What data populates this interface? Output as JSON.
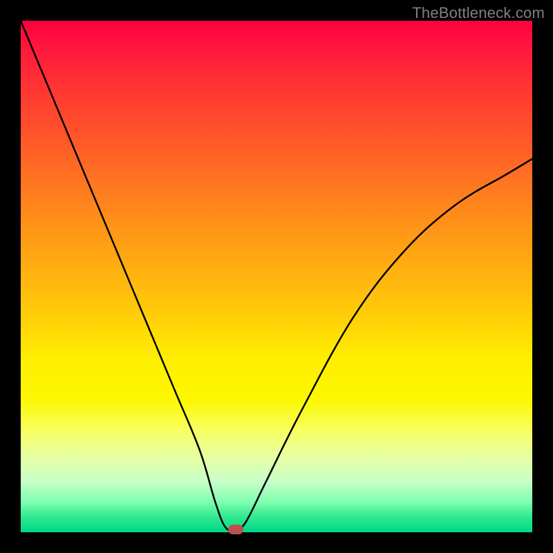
{
  "watermark": "TheBottleneck.com",
  "chart_data": {
    "type": "line",
    "title": "",
    "xlabel": "",
    "ylabel": "",
    "xlim": [
      0,
      100
    ],
    "ylim": [
      0,
      100
    ],
    "grid": false,
    "legend": false,
    "background_gradient": {
      "top": "#ff0040",
      "middle": "#ffee00",
      "bottom": "#00d888"
    },
    "series": [
      {
        "name": "bottleneck-curve",
        "color": "#000000",
        "x": [
          0,
          5,
          10,
          15,
          20,
          25,
          30,
          35,
          38,
          40,
          42,
          44,
          48,
          55,
          65,
          75,
          85,
          95,
          100
        ],
        "y": [
          100,
          88,
          76,
          64,
          52,
          40,
          28,
          16,
          6,
          1,
          0.5,
          2,
          10,
          24,
          42,
          55,
          64,
          70,
          73
        ]
      }
    ],
    "marker": {
      "x": 42,
      "y": 0.5,
      "color": "#c05050"
    }
  }
}
